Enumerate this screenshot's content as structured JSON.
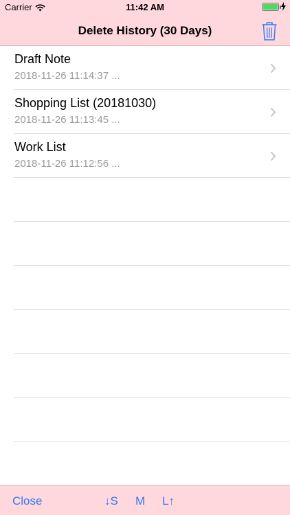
{
  "status_bar": {
    "carrier": "Carrier",
    "time": "11:42 AM",
    "battery_level": 1.0,
    "battery_color": "#4cd964"
  },
  "nav": {
    "title": "Delete History (30 Days)",
    "trash_icon": "trash-icon"
  },
  "items": [
    {
      "title": "Draft Note",
      "date": "2018-11-26 11:14:37 ..."
    },
    {
      "title": "Shopping List (20181030)",
      "date": "2018-11-26 11:13:45 ..."
    },
    {
      "title": "Work List",
      "date": "2018-11-26 11:12:56 ..."
    }
  ],
  "toolbar": {
    "close_label": "Close",
    "small_label": "↓S",
    "medium_label": "M",
    "large_label": "L↑"
  },
  "colors": {
    "bar_background": "#fed8dc",
    "accent": "#2f7bf6",
    "secondary_text": "#9b9ba0"
  }
}
